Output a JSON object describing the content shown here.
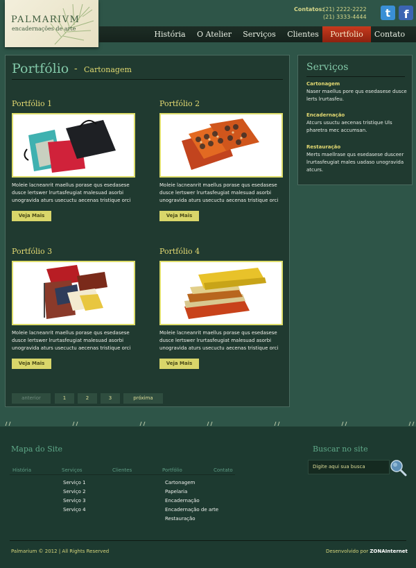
{
  "brand": {
    "name": "PALMARIVM",
    "tagline": "encadernações de arte"
  },
  "contacts": {
    "label": "Contatos:",
    "phones": [
      "(21) 2222-2222",
      "(21) 3333-4444"
    ]
  },
  "social": [
    {
      "icon": "twitter-icon",
      "color": "#3a8fd6"
    },
    {
      "icon": "facebook-icon",
      "color": "#3b64b3"
    }
  ],
  "nav": {
    "items": [
      "História",
      "O Atelier",
      "Serviços",
      "Clientes",
      "Portfolio",
      "Contato"
    ],
    "active": "Portfolio"
  },
  "page": {
    "title": "Portfólio",
    "separator": "-",
    "subtitle": "Cartonagem"
  },
  "portfolio": {
    "button_label": "Veja Mais",
    "items": [
      {
        "title": "Portfólio 1",
        "text": "Moleie lacneanrit maellus porase qus esedasese dusce lertswer lrurtasfeugiat malesuad asorbi unogravida aturs usecuctu aecenas tristique orci"
      },
      {
        "title": "Portfólio 2",
        "text": "Moleie lacneanrit maellus porase qus esedasese dusce lertswer lrurtasfeugiat malesuad asorbi unogravida aturs usecuctu aecenas tristique orci"
      },
      {
        "title": "Portfólio 3",
        "text": "Moleie lacneanrit maellus porase qus esedasese dusce lertswer lrurtasfeugiat malesuad asorbi unogravida aturs usecuctu aecenas tristique orci"
      },
      {
        "title": "Portfólio 4",
        "text": "Moleie lacneanrit maellus porase qus esedasese dusce lertswer lrurtasfeugiat malesuad asorbi unogravida aturs usecuctu aecenas tristique orci"
      }
    ]
  },
  "pagination": {
    "prev": "anterior",
    "pages": [
      "1",
      "2",
      "3"
    ],
    "next": "próxima"
  },
  "sidebar": {
    "title": "Serviços",
    "services": [
      {
        "heading": "Cartonagem",
        "text": "Naser maellus pore qus esedasese dusce lerts lrurtasfeu."
      },
      {
        "heading": "Encadernação",
        "text": "Atcurs usuctu aecenas tristique Uls pharetra mec accumsan."
      },
      {
        "heading": "Restauração",
        "text": "Merts maellrase qus esedasese dusceer lrurtasfeugiat males uadaso unogravida atcurs."
      }
    ]
  },
  "footer": {
    "sitemap_title": "Mapa do Site",
    "columns": [
      "História",
      "Serviços",
      "Clientes",
      "Portfólio",
      "Contato"
    ],
    "servicos_links": [
      "Serviço 1",
      "Serviço 2",
      "Serviço 3",
      "Serviço 4"
    ],
    "portfolio_links": [
      "Cartonagem",
      "Papelaria",
      "Encadernação",
      "Encadernação de arte",
      "Restauração"
    ],
    "search_title": "Buscar no site",
    "search_placeholder": "Digite aqui sua busca",
    "copyright": "Palmarium © 2012 | All Rights Reserved",
    "developed_by": "Desenvolvido por",
    "developer": "ZONAInternet"
  },
  "colors": {
    "background": "#2e5548",
    "accent_gold": "#e4da72",
    "accent_teal": "#83c9a9",
    "nav_active": "#c73a1d"
  }
}
